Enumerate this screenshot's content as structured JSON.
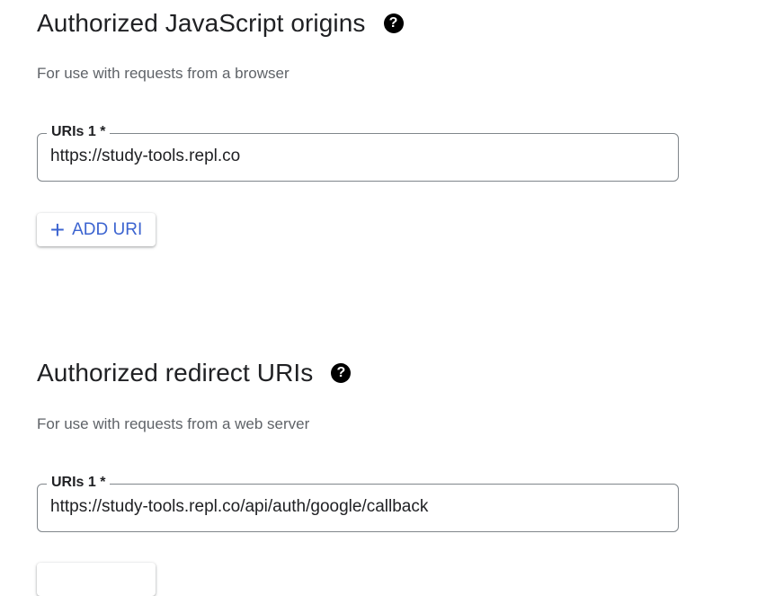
{
  "js_origins": {
    "title": "Authorized JavaScript origins",
    "help_icon": "question-circle-icon",
    "subtitle": "For use with requests from a browser",
    "field_label": "URIs 1 *",
    "field_value": "https://study-tools.repl.co",
    "add_button": "ADD URI",
    "add_icon": "plus-icon"
  },
  "redirect_uris": {
    "title": "Authorized redirect URIs",
    "help_icon": "question-circle-icon",
    "subtitle": "For use with requests from a web server",
    "field_label": "URIs 1 *",
    "field_value": "https://study-tools.repl.co/api/auth/google/callback"
  },
  "colors": {
    "accent": "#3c64d0",
    "border": "#80868b",
    "muted": "#5f6368"
  }
}
